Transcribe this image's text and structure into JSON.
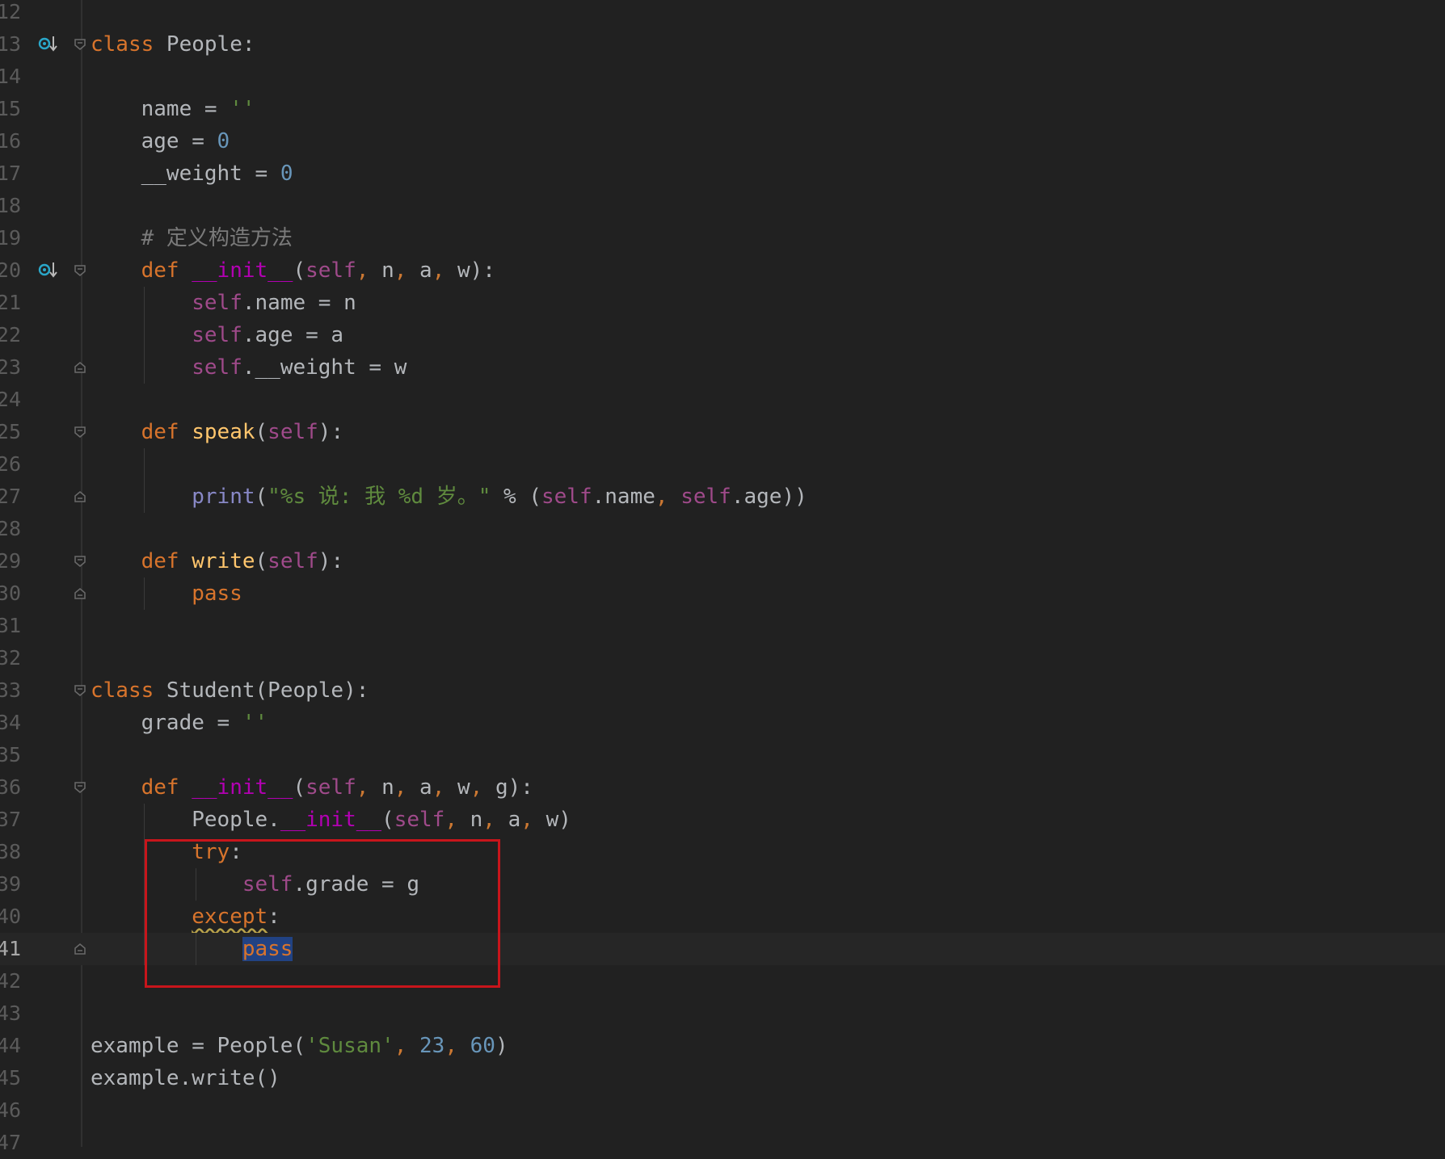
{
  "editor": {
    "lines": [
      {
        "n": "12",
        "tokens": []
      },
      {
        "n": "13",
        "tokens": [
          [
            "kw",
            "class"
          ],
          [
            "text",
            " People:"
          ]
        ]
      },
      {
        "n": "14",
        "tokens": []
      },
      {
        "n": "15",
        "tokens": [
          [
            "text",
            "    name = "
          ],
          [
            "str",
            "''"
          ]
        ]
      },
      {
        "n": "16",
        "tokens": [
          [
            "text",
            "    age = "
          ],
          [
            "num",
            "0"
          ]
        ]
      },
      {
        "n": "17",
        "tokens": [
          [
            "text",
            "    __weight = "
          ],
          [
            "num",
            "0"
          ]
        ]
      },
      {
        "n": "18",
        "tokens": []
      },
      {
        "n": "19",
        "tokens": [
          [
            "comment",
            "    # 定义构造方法"
          ]
        ]
      },
      {
        "n": "20",
        "tokens": [
          [
            "kw",
            "    def "
          ],
          [
            "magic",
            "__init__"
          ],
          [
            "text",
            "("
          ],
          [
            "self",
            "self"
          ],
          [
            "punc",
            ", "
          ],
          [
            "text",
            "n"
          ],
          [
            "punc",
            ", "
          ],
          [
            "text",
            "a"
          ],
          [
            "punc",
            ", "
          ],
          [
            "text",
            "w):"
          ]
        ]
      },
      {
        "n": "21",
        "tokens": [
          [
            "text",
            "        "
          ],
          [
            "self",
            "self"
          ],
          [
            "text",
            ".name = n"
          ]
        ]
      },
      {
        "n": "22",
        "tokens": [
          [
            "text",
            "        "
          ],
          [
            "self",
            "self"
          ],
          [
            "text",
            ".age = a"
          ]
        ]
      },
      {
        "n": "23",
        "tokens": [
          [
            "text",
            "        "
          ],
          [
            "self",
            "self"
          ],
          [
            "text",
            ".__weight = w"
          ]
        ]
      },
      {
        "n": "24",
        "tokens": []
      },
      {
        "n": "25",
        "tokens": [
          [
            "kw",
            "    def "
          ],
          [
            "fn",
            "speak"
          ],
          [
            "text",
            "("
          ],
          [
            "self",
            "self"
          ],
          [
            "text",
            "):"
          ]
        ]
      },
      {
        "n": "26",
        "tokens": []
      },
      {
        "n": "27",
        "tokens": [
          [
            "text",
            "        "
          ],
          [
            "builtin",
            "print"
          ],
          [
            "text",
            "("
          ],
          [
            "str",
            "\"%s 说: 我 %d 岁。\""
          ],
          [
            "text",
            " % ("
          ],
          [
            "self",
            "self"
          ],
          [
            "text",
            ".name"
          ],
          [
            "punc",
            ", "
          ],
          [
            "self",
            "self"
          ],
          [
            "text",
            ".age))"
          ]
        ]
      },
      {
        "n": "28",
        "tokens": []
      },
      {
        "n": "29",
        "tokens": [
          [
            "kw",
            "    def "
          ],
          [
            "fn",
            "write"
          ],
          [
            "text",
            "("
          ],
          [
            "self",
            "self"
          ],
          [
            "text",
            "):"
          ]
        ]
      },
      {
        "n": "30",
        "tokens": [
          [
            "kw",
            "        pass"
          ]
        ]
      },
      {
        "n": "31",
        "tokens": []
      },
      {
        "n": "32",
        "tokens": []
      },
      {
        "n": "33",
        "tokens": [
          [
            "kw",
            "class"
          ],
          [
            "text",
            " Student(People):"
          ]
        ]
      },
      {
        "n": "34",
        "tokens": [
          [
            "text",
            "    grade = "
          ],
          [
            "str",
            "''"
          ]
        ]
      },
      {
        "n": "35",
        "tokens": []
      },
      {
        "n": "36",
        "tokens": [
          [
            "kw",
            "    def "
          ],
          [
            "magic",
            "__init__"
          ],
          [
            "text",
            "("
          ],
          [
            "self",
            "self"
          ],
          [
            "punc",
            ", "
          ],
          [
            "text",
            "n"
          ],
          [
            "punc",
            ", "
          ],
          [
            "text",
            "a"
          ],
          [
            "punc",
            ", "
          ],
          [
            "text",
            "w"
          ],
          [
            "punc",
            ", "
          ],
          [
            "text",
            "g):"
          ]
        ]
      },
      {
        "n": "37",
        "tokens": [
          [
            "text",
            "        People."
          ],
          [
            "magic",
            "__init__"
          ],
          [
            "text",
            "("
          ],
          [
            "self",
            "self"
          ],
          [
            "punc",
            ", "
          ],
          [
            "text",
            "n"
          ],
          [
            "punc",
            ", "
          ],
          [
            "text",
            "a"
          ],
          [
            "punc",
            ", "
          ],
          [
            "text",
            "w)"
          ]
        ]
      },
      {
        "n": "38",
        "tokens": [
          [
            "kw",
            "        try"
          ],
          [
            "text",
            ":"
          ]
        ]
      },
      {
        "n": "39",
        "tokens": [
          [
            "text",
            "            "
          ],
          [
            "self",
            "self"
          ],
          [
            "text",
            ".grade = g"
          ]
        ]
      },
      {
        "n": "40",
        "tokens": [
          [
            "text",
            "        "
          ],
          [
            "kwsq",
            "except"
          ],
          [
            "text",
            ":"
          ]
        ]
      },
      {
        "n": "41",
        "tokens": [
          [
            "text",
            "            "
          ],
          [
            "kwsel",
            "pass"
          ]
        ],
        "current": true
      },
      {
        "n": "42",
        "tokens": []
      },
      {
        "n": "43",
        "tokens": []
      },
      {
        "n": "44",
        "tokens": [
          [
            "text",
            "example = People("
          ],
          [
            "str",
            "'Susan'"
          ],
          [
            "punc",
            ", "
          ],
          [
            "num",
            "23"
          ],
          [
            "punc",
            ", "
          ],
          [
            "num",
            "60"
          ],
          [
            "text",
            ")"
          ]
        ]
      },
      {
        "n": "45",
        "tokens": [
          [
            "text",
            "example.write()"
          ]
        ]
      },
      {
        "n": "46",
        "tokens": []
      },
      {
        "n": "47",
        "tokens": []
      }
    ],
    "fold_markers": [
      {
        "line": "13",
        "kind": "open"
      },
      {
        "line": "20",
        "kind": "open"
      },
      {
        "line": "23",
        "kind": "close"
      },
      {
        "line": "25",
        "kind": "open"
      },
      {
        "line": "27",
        "kind": "close"
      },
      {
        "line": "29",
        "kind": "open"
      },
      {
        "line": "30",
        "kind": "close"
      },
      {
        "line": "33",
        "kind": "open"
      },
      {
        "line": "36",
        "kind": "open"
      },
      {
        "line": "41",
        "kind": "close"
      }
    ],
    "override_markers": [
      "13",
      "20"
    ],
    "annotation": {
      "kind": "highlight-box",
      "color": "#c8151b"
    },
    "colors": {
      "background": "#212121",
      "keyword": "#d8742c",
      "self": "#9f4a8a",
      "magic": "#b200b2",
      "function": "#ffc66d",
      "string": "#5f8a3e",
      "number": "#6896ba",
      "comment": "#7a7a7a"
    }
  }
}
